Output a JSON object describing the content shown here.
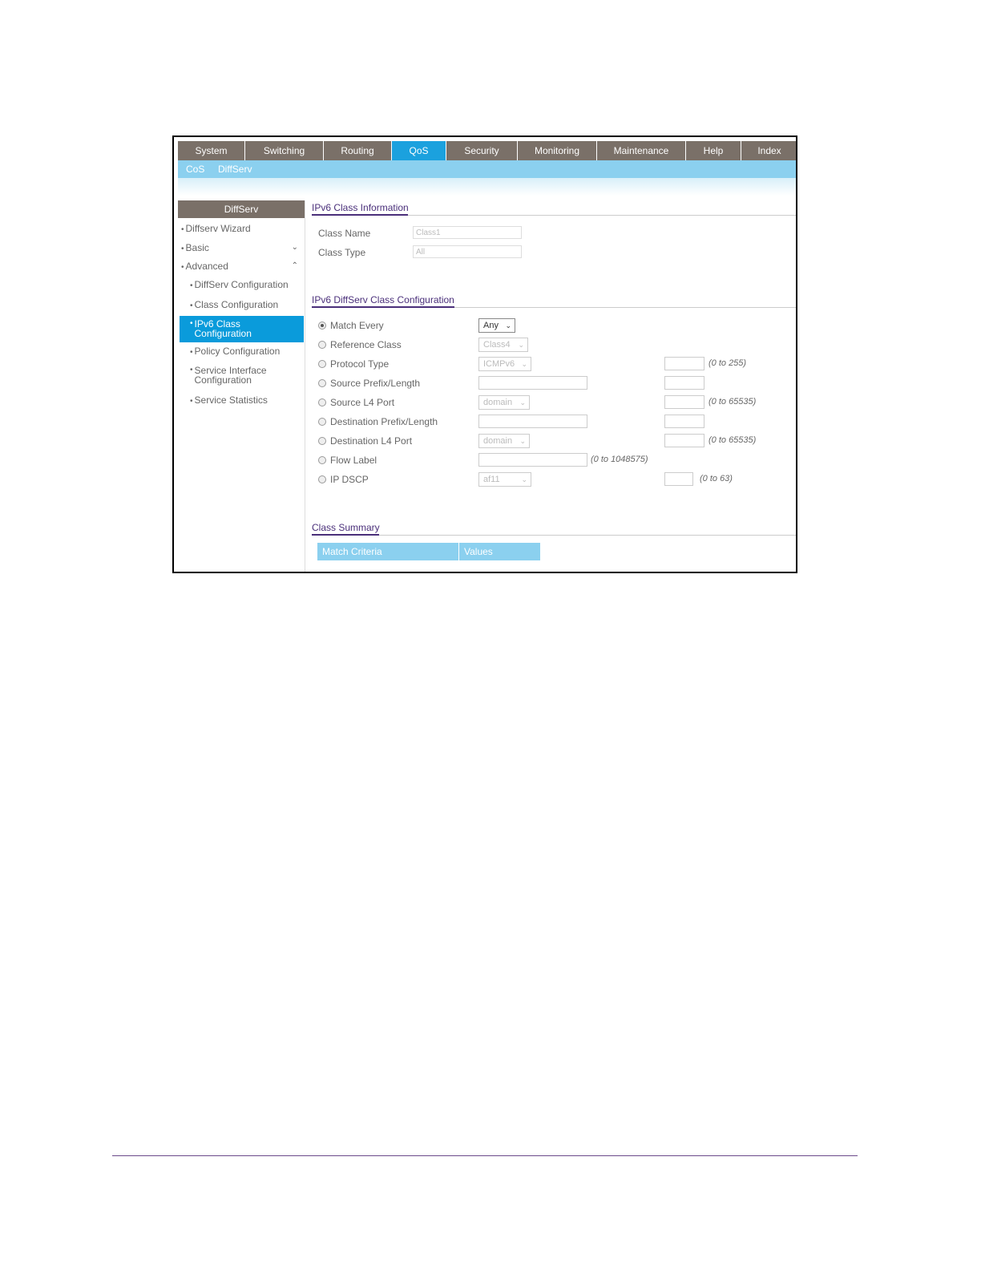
{
  "top_nav": [
    "System",
    "Switching",
    "Routing",
    "QoS",
    "Security",
    "Monitoring",
    "Maintenance",
    "Help",
    "Index"
  ],
  "top_nav_active": "QoS",
  "sub_nav": [
    "CoS",
    "DiffServ"
  ],
  "sidebar": {
    "title": "DiffServ",
    "items": [
      {
        "label": "Diffserv Wizard"
      },
      {
        "label": "Basic"
      },
      {
        "label": "Advanced"
      },
      {
        "label": "DiffServ Configuration"
      },
      {
        "label": "Class Configuration"
      },
      {
        "label": "IPv6 Class Configuration"
      },
      {
        "label": "Policy Configuration"
      },
      {
        "label": "Service Interface Configuration"
      },
      {
        "label": "Service Statistics"
      }
    ]
  },
  "class_info": {
    "title": "IPv6 Class Information",
    "class_name_label": "Class Name",
    "class_name_value": "Class1",
    "class_type_label": "Class Type",
    "class_type_value": "All"
  },
  "class_config": {
    "title": "IPv6 DiffServ Class Configuration",
    "rows": [
      {
        "label": "Match Every",
        "select": "Any",
        "range": ""
      },
      {
        "label": "Reference Class",
        "select": "Class4",
        "range": ""
      },
      {
        "label": "Protocol Type",
        "select": "ICMPv6",
        "range": "(0 to 255)"
      },
      {
        "label": "Source Prefix/Length",
        "select": "",
        "range": ""
      },
      {
        "label": "Source L4 Port",
        "select": "domain",
        "range": "(0 to 65535)"
      },
      {
        "label": "Destination Prefix/Length",
        "select": "",
        "range": ""
      },
      {
        "label": "Destination L4 Port",
        "select": "domain",
        "range": "(0 to 65535)"
      },
      {
        "label": "Flow Label",
        "select": "",
        "range": "(0 to 1048575)"
      },
      {
        "label": "IP DSCP",
        "select": "af11",
        "range": "(0 to 63)"
      }
    ]
  },
  "summary": {
    "title": "Class Summary",
    "columns": [
      "Match Criteria",
      "Values"
    ]
  }
}
